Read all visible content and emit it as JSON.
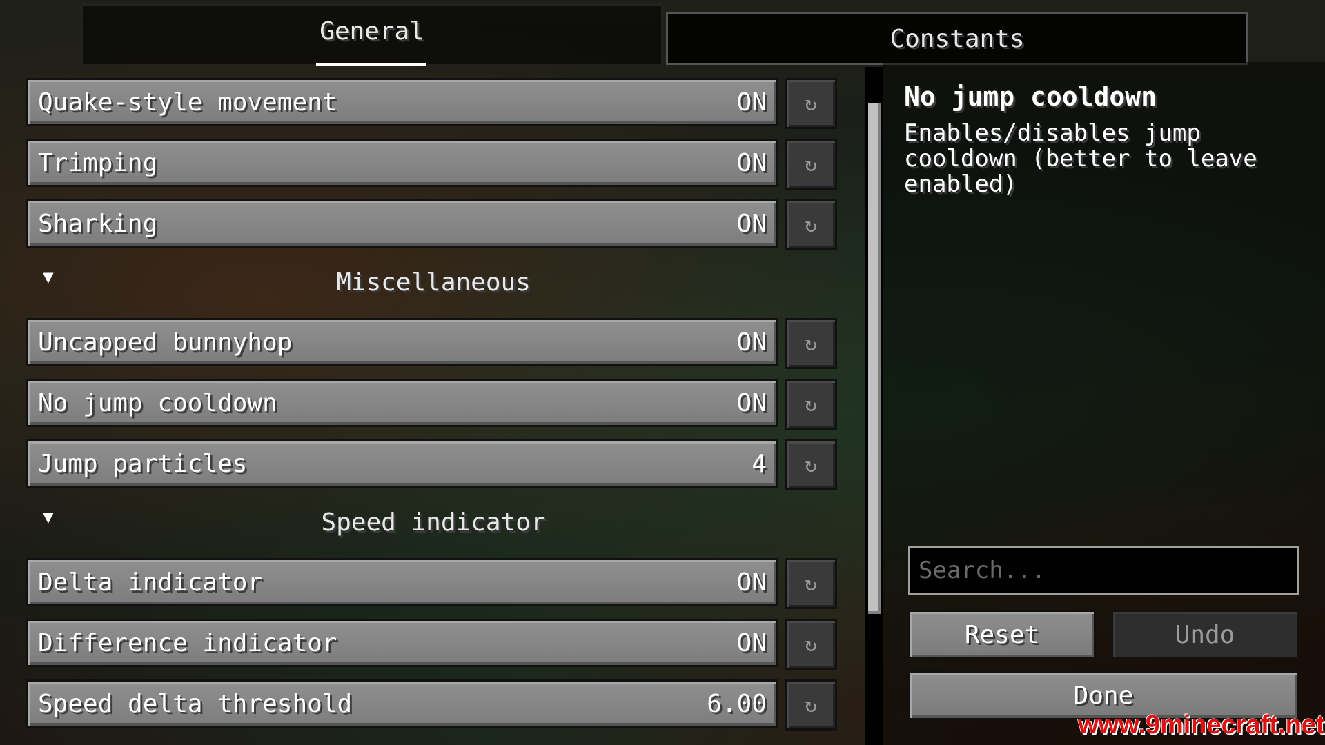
{
  "tabs": [
    {
      "label": "General",
      "active": true
    },
    {
      "label": "Constants",
      "active": false
    }
  ],
  "options": [
    {
      "type": "option",
      "label": "Quake-style movement",
      "value": "ON"
    },
    {
      "type": "option",
      "label": "Trimping",
      "value": "ON"
    },
    {
      "type": "option",
      "label": "Sharking",
      "value": "ON"
    },
    {
      "type": "category",
      "label": "Miscellaneous"
    },
    {
      "type": "option",
      "label": "Uncapped bunnyhop",
      "value": "ON"
    },
    {
      "type": "option",
      "label": "No jump cooldown",
      "value": "ON"
    },
    {
      "type": "option",
      "label": "Jump particles",
      "value": "4"
    },
    {
      "type": "category",
      "label": "Speed indicator"
    },
    {
      "type": "option",
      "label": "Delta indicator",
      "value": "ON"
    },
    {
      "type": "option",
      "label": "Difference indicator",
      "value": "ON"
    },
    {
      "type": "option",
      "label": "Speed delta threshold",
      "value": "6.00"
    }
  ],
  "icons": {
    "reset": "reset-icon",
    "collapse": "collapse-arrow-icon"
  },
  "description": {
    "title": "No jump cooldown",
    "body": "Enables/disables jump cooldown (better to leave enabled)"
  },
  "search": {
    "placeholder": "Search...",
    "value": ""
  },
  "buttons": {
    "reset": "Reset",
    "undo": "Undo",
    "done": "Done"
  },
  "watermark": "www.9minecraft.net"
}
